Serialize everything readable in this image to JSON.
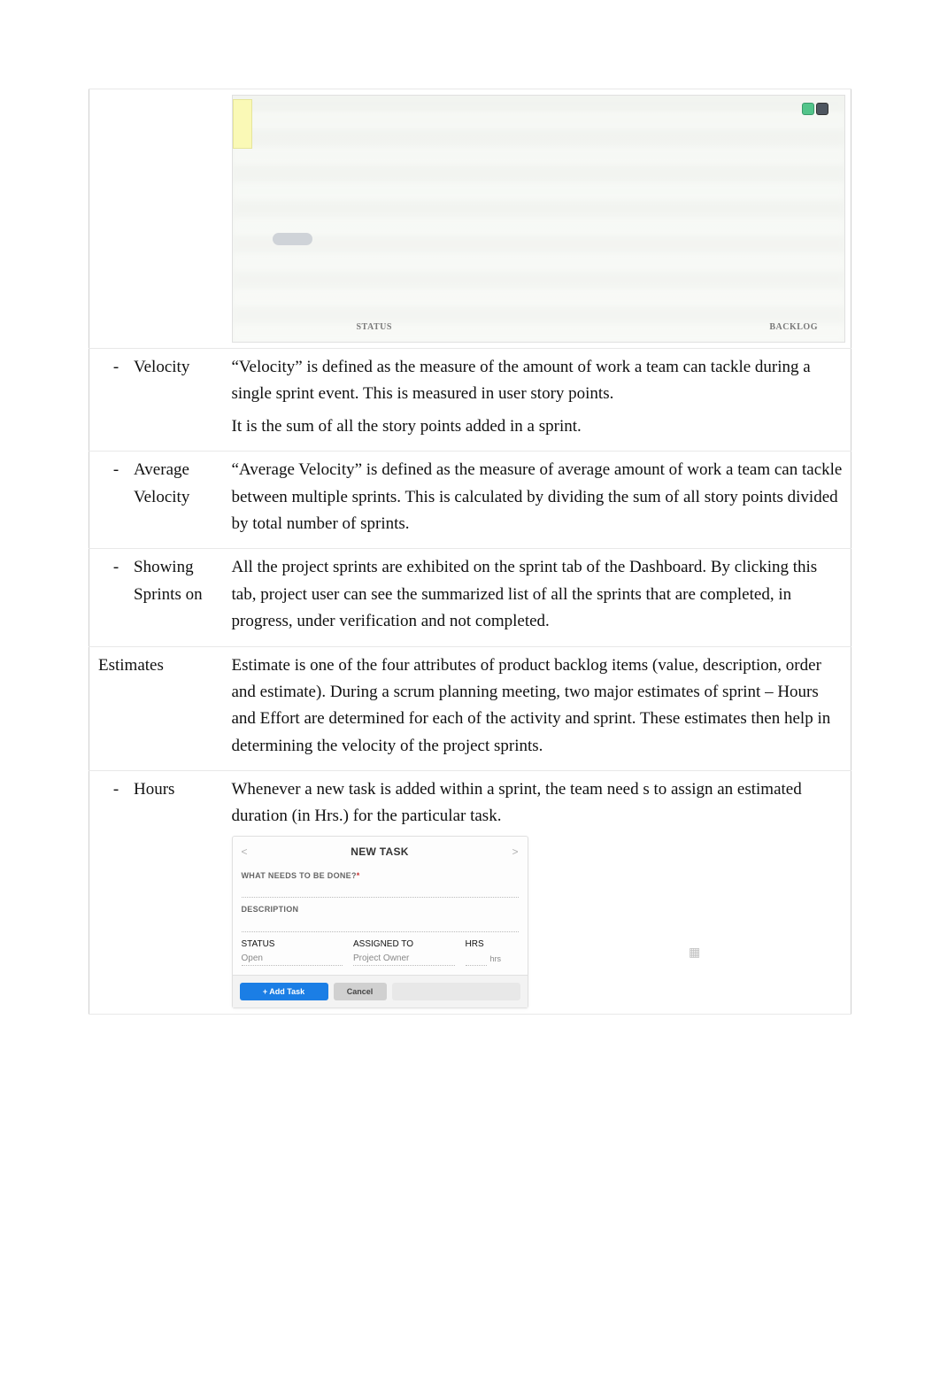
{
  "top_image": {
    "alt": "Project dashboard screenshot (blurred)",
    "col_left": "STATUS",
    "col_right": "BACKLOG"
  },
  "rows": [
    {
      "dash": "-",
      "label": "Velocity",
      "desc": [
        "“Velocity” is defined as the measure of the amount of work a team can tackle during a single sprint event. This is measured in user story points.",
        "It is the sum of all the story points added in a sprint."
      ]
    },
    {
      "dash": "-",
      "label": "Average Velocity",
      "desc": [
        "“Average Velocity” is defined as the measure of average amount of work a team can tackle between multiple sprints. This is calculated by dividing the sum of all story points divided by total number of sprints."
      ]
    },
    {
      "dash": "-",
      "label": "Showing Sprints on",
      "desc": [
        "All the project sprints are exhibited on the sprint tab of the Dashboard. By clicking this tab, project user can see the summarized list of all the sprints that are completed, in progress, under verification and not completed."
      ]
    },
    {
      "dash": "",
      "label": "Estimates",
      "desc": [
        "Estimate is one of the four attributes of product backlog items (value, description, order and estimate).  During a scrum planning meeting, two major estimates of sprint – Hours and Effort are determined for each of the activity and sprint. These estimates then help in determining the velocity of the project sprints."
      ]
    },
    {
      "dash": "-",
      "label": "Hours",
      "desc": [
        "Whenever a new task is added within a sprint, the team need s to assign an estimated duration (in Hrs.) for the particular task."
      ]
    }
  ],
  "form": {
    "title": "NEW TASK",
    "nav_prev": "<",
    "nav_next": ">",
    "field_activity_label": "WHAT NEEDS TO BE DONE?",
    "field_activity_req": "*",
    "field_desc_label": "DESCRIPTION",
    "field_status_label": "STATUS",
    "field_status_value": "Open",
    "field_assignee_label": "ASSIGNED TO",
    "field_assignee_value": "Project Owner",
    "field_hrs_label": "HRS",
    "field_hrs_value": "",
    "hrs_suffix": "hrs",
    "btn_primary": "+ Add Task",
    "btn_secondary": "Cancel"
  }
}
